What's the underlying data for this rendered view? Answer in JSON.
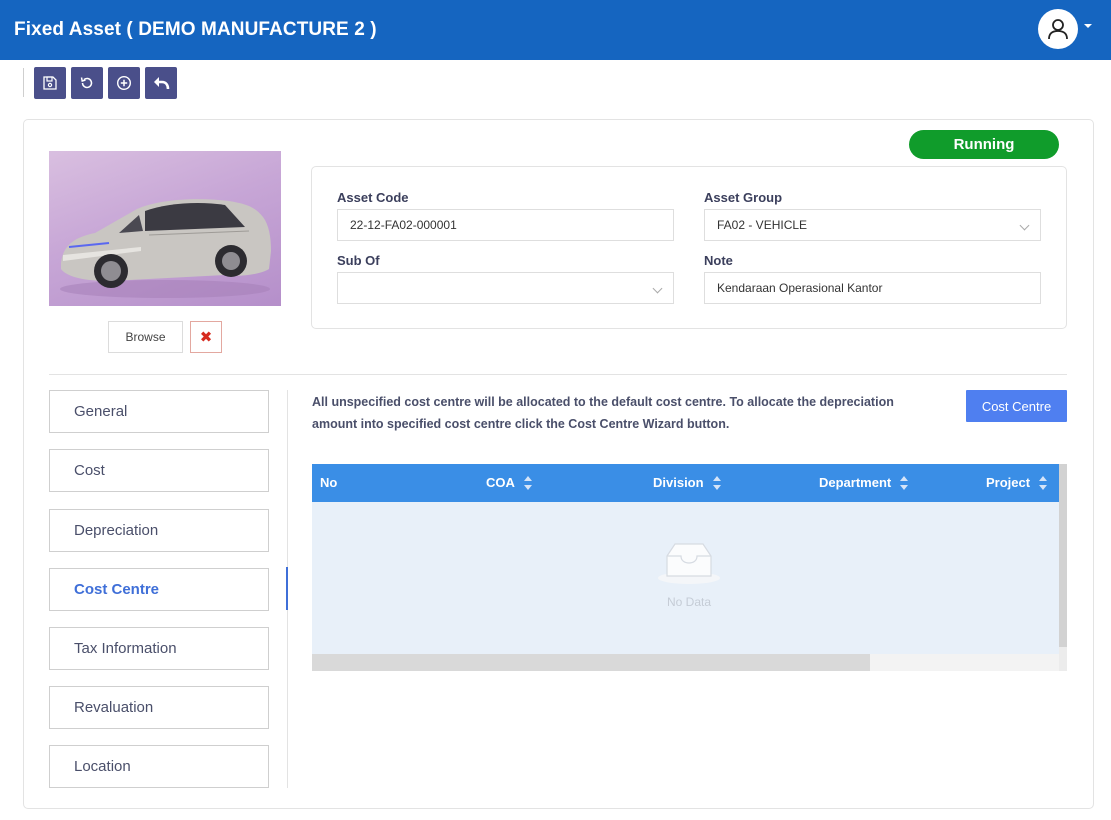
{
  "header": {
    "title": "Fixed Asset ( DEMO MANUFACTURE 2 )",
    "user_icon": "user-icon"
  },
  "toolbar": {
    "buttons": [
      {
        "icon": "save-icon"
      },
      {
        "icon": "refresh-icon"
      },
      {
        "icon": "add-icon"
      },
      {
        "icon": "back-icon"
      }
    ]
  },
  "status": {
    "label": "Running",
    "color": "#109c2b"
  },
  "image_actions": {
    "browse_label": "Browse",
    "remove_icon": "close-icon",
    "remove_glyph": "✖"
  },
  "form": {
    "asset_code_label": "Asset Code",
    "asset_code_value": "22-12-FA02-000001",
    "asset_group_label": "Asset Group",
    "asset_group_value": "FA02 - VEHICLE",
    "sub_of_label": "Sub Of",
    "sub_of_value": "",
    "note_label": "Note",
    "note_value": "Kendaraan Operasional Kantor"
  },
  "tabs": [
    {
      "label": "General"
    },
    {
      "label": "Cost"
    },
    {
      "label": "Depreciation"
    },
    {
      "label": "Cost Centre",
      "active": true
    },
    {
      "label": "Tax Information"
    },
    {
      "label": "Revaluation"
    },
    {
      "label": "Location"
    }
  ],
  "cost_centre": {
    "info_text": "All unspecified cost centre will be allocated to the default cost centre. To allocate the depreciation amount into specified cost centre click the Cost Centre Wizard button.",
    "button_label": "Cost Centre",
    "columns": [
      "No",
      "COA",
      "Division",
      "Department",
      "Project"
    ],
    "empty_text": "No Data"
  },
  "colors": {
    "header_bg": "#1565c0",
    "toolbar_btn": "#4a4f8a",
    "accent": "#3f6fd8",
    "grid_header": "#3a8ee6",
    "button_primary": "#4f7ff0"
  }
}
